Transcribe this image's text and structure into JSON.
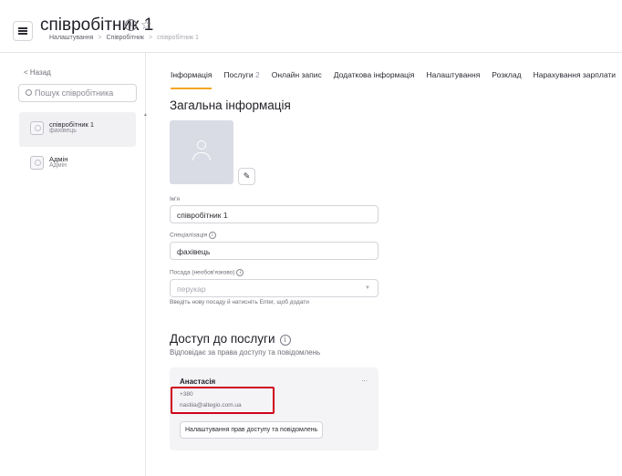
{
  "header": {
    "title": "співробітник 1",
    "breadcrumb": [
      "Налаштування",
      "Співробітник",
      "співробітник 1"
    ],
    "separator": ">"
  },
  "sidebar": {
    "back_label": "Назад",
    "back_arrow": "<",
    "search_placeholder": "Пошук співробітника",
    "employees": [
      {
        "name": "співробітник 1",
        "role": "фахівець",
        "active": true
      },
      {
        "name": "Адмін",
        "role": "Адмін",
        "active": false
      }
    ]
  },
  "tabs": [
    {
      "label": "Інформація",
      "active": true
    },
    {
      "label": "Послуги",
      "count": "2"
    },
    {
      "label": "Онлайн запис"
    },
    {
      "label": "Додаткова інформація"
    },
    {
      "label": "Налаштування"
    },
    {
      "label": "Розклад"
    },
    {
      "label": "Нарахування зарплати"
    }
  ],
  "general": {
    "heading": "Загальна інформація",
    "name_label": "Ім'я",
    "name_value": "співробітник 1",
    "spec_label": "Спеціалізація",
    "spec_value": "фахівець",
    "position_label": "Посада (необов'язково)",
    "position_placeholder": "перукар",
    "position_hint": "Введіть нову посаду й натисніть Enter, щоб додати"
  },
  "access": {
    "heading": "Доступ до послуги",
    "subtitle": "Відповідає за права доступу та повідомлень",
    "user_name": "Анастасія",
    "phone": "+380",
    "email": "nastiia@altegio.com.ua",
    "more": "...",
    "permissions_button": "Налаштування прав доступу та повідомлень"
  },
  "colors": {
    "accent_tab": "#f5a623",
    "highlight_box": "#d0021b",
    "photo_bg": "#d9dbe5"
  }
}
